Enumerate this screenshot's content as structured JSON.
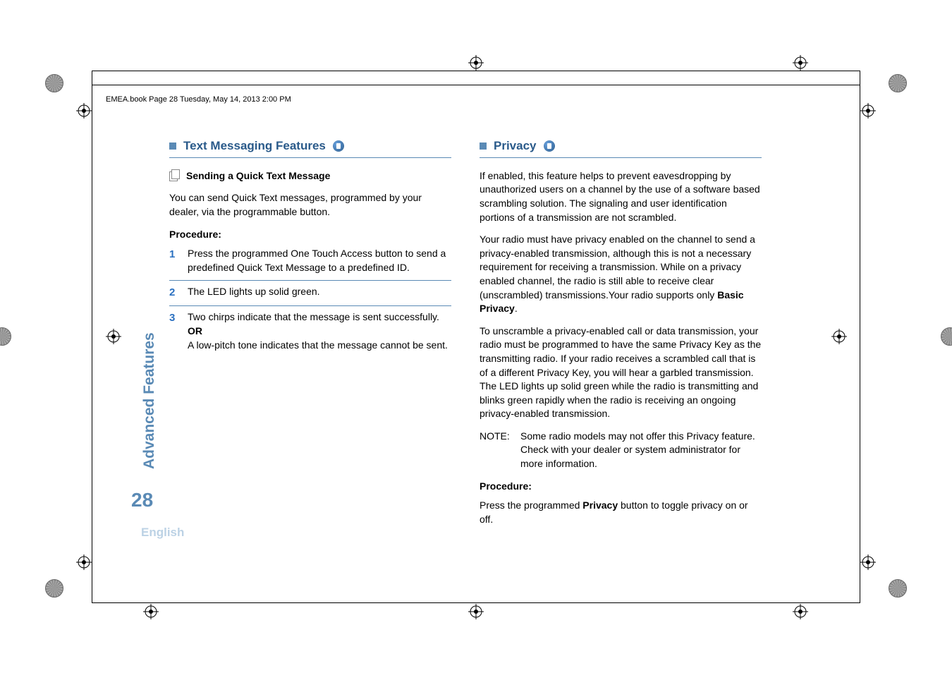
{
  "header": {
    "running_head": "EMEA.book  Page 28  Tuesday, May 14, 2013  2:00 PM"
  },
  "sidebar": {
    "section_label": "Advanced Features",
    "page_number": "28",
    "language": "English"
  },
  "left": {
    "section_title": "Text Messaging Features",
    "sub_title": "Sending a Quick Text Message",
    "intro": "You can send Quick Text messages, programmed by your dealer, via the programmable button.",
    "procedure_label": "Procedure:",
    "steps": [
      {
        "num": "1",
        "text": "Press the programmed One Touch Access button to send a predefined Quick Text Message to a predefined ID."
      },
      {
        "num": "2",
        "text": "The LED lights up solid green."
      },
      {
        "num": "3",
        "text_a": "Two chirps indicate that the message is sent successfully.",
        "or": "OR",
        "text_b": "A low-pitch tone indicates that the message cannot be sent."
      }
    ]
  },
  "right": {
    "section_title": "Privacy",
    "p1_a": "If enabled, this feature helps to prevent eavesdropping by unauthorized users on a channel by the use of a software based scrambling solution. The signaling and user identification portions of a transmission are not scrambled.",
    "p2_a": "Your radio must have privacy enabled on the channel to send a privacy-enabled transmission, although this is not a necessary requirement for receiving a transmission. While on a privacy enabled channel, the radio is still able to receive clear (unscrambled) transmissions.Your radio supports only ",
    "p2_bold": "Basic Privacy",
    "p2_end": ".",
    "p3": "To unscramble a privacy-enabled call or data transmission, your radio must be programmed to have the same Privacy Key as the transmitting radio. If your radio receives a scrambled call that is of a different Privacy Key, you will hear a garbled transmission. The LED lights up solid green while the radio is transmitting and blinks green rapidly when the radio is receiving an ongoing privacy-enabled transmission.",
    "note_label": "NOTE:",
    "note_text": "Some radio models may not offer this Privacy feature. Check with your dealer or system administrator for more information.",
    "procedure_label": "Procedure:",
    "proc_a": "Press the programmed ",
    "proc_bold": "Privacy",
    "proc_b": " button to toggle privacy on or off."
  }
}
